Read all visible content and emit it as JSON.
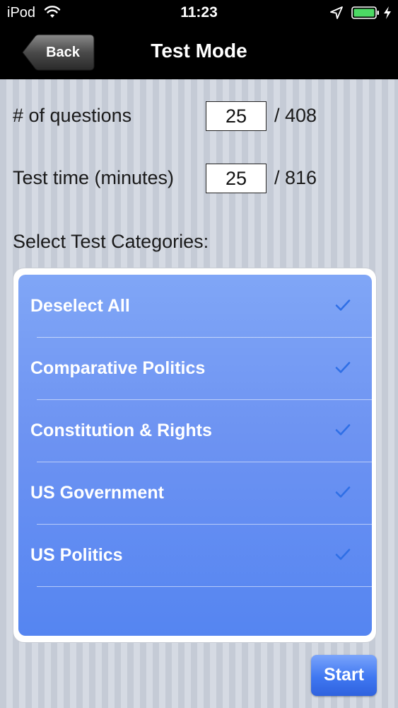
{
  "status_bar": {
    "carrier": "iPod",
    "time": "11:23"
  },
  "nav": {
    "back_label": "Back",
    "title": "Test Mode"
  },
  "form": {
    "questions": {
      "label": "# of questions",
      "value": "25",
      "total": "/ 408"
    },
    "test_time": {
      "label": "Test time (minutes)",
      "value": "25",
      "total": "/ 816"
    },
    "categories_label": "Select Test Categories:"
  },
  "categories": [
    {
      "label": "Deselect All",
      "checked": true
    },
    {
      "label": "Comparative Politics",
      "checked": true
    },
    {
      "label": "Constitution & Rights",
      "checked": true
    },
    {
      "label": "US Government",
      "checked": true
    },
    {
      "label": "US Politics",
      "checked": true
    }
  ],
  "start_label": "Start",
  "colors": {
    "nav_background": "#000000",
    "list_top": "#80a6f6",
    "list_bottom": "#5585f1",
    "checkmark": "#2f6fe6",
    "battery": "#4cd964"
  }
}
